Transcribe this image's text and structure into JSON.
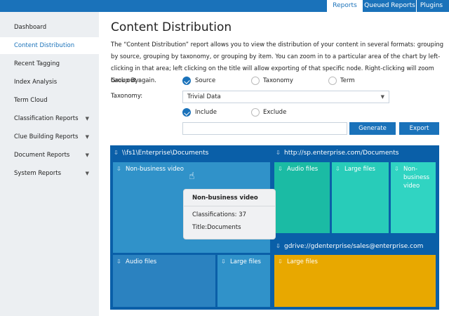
{
  "tabs": [
    {
      "label": "Reports",
      "active": true
    },
    {
      "label": "Queued Reports"
    },
    {
      "label": "Plugins"
    }
  ],
  "sidebar": {
    "items": [
      {
        "label": "Dashboard"
      },
      {
        "label": "Content Distribution",
        "active": true
      },
      {
        "label": "Recent Tagging"
      },
      {
        "label": "Index Analysis"
      },
      {
        "label": "Term Cloud"
      },
      {
        "label": "Classification Reports",
        "expandable": true
      },
      {
        "label": "Clue Building Reports",
        "expandable": true
      },
      {
        "label": "Document Reports",
        "expandable": true
      },
      {
        "label": "System Reports",
        "expandable": true
      }
    ]
  },
  "main": {
    "title": "Content Distribution",
    "description": "The “Content Distribution” report allows you to view the distribution of your content in several formats: grouping by source, grouping by taxonomy, or grouping by item. You can zoom in to a particular area of the chart by left-clicking in that area; left clicking on the title will allow exporting of that specific node. Right-clicking will zoom back out again.",
    "group_by_label": "Group By:",
    "group_by_options": [
      {
        "label": "Source",
        "selected": true
      },
      {
        "label": "Taxonomy"
      },
      {
        "label": "Term"
      }
    ],
    "taxonomy_label": "Taxonomy:",
    "taxonomy_value": "Trivial Data",
    "filter_options": [
      {
        "label": "Include",
        "selected": true
      },
      {
        "label": "Exclude"
      }
    ],
    "filter_value": "",
    "generate_label": "Generate",
    "export_label": "Export"
  },
  "treemap": {
    "groups": [
      {
        "title": "\\\\fs1\\Enterprise\\Documents",
        "items": [
          {
            "label": "Non-business video",
            "color": "#3092c9"
          },
          {
            "label": "Audio files",
            "color": "#2b82c0"
          },
          {
            "label": "Large files",
            "color": "#3092c9"
          }
        ]
      },
      {
        "title": "http://sp.enterprise.com/Documents",
        "items": [
          {
            "label": "Audio files",
            "color": "#1bbba4"
          },
          {
            "label": "Large files",
            "color": "#28ccb9"
          },
          {
            "label": "Non-business video",
            "color": "#30d4c2"
          }
        ]
      },
      {
        "title": "gdrive://gdenterprise/sales@enterprise.com",
        "items": [
          {
            "label": "Large files",
            "color": "#e8a800"
          }
        ]
      }
    ],
    "tooltip": {
      "title": "Non-business video",
      "classifications": "Classifications: 37",
      "doc_title": "Title:Documents"
    }
  },
  "colors": {
    "accent": "#1a72ba",
    "treemap_bg": "#0a5fa8"
  }
}
